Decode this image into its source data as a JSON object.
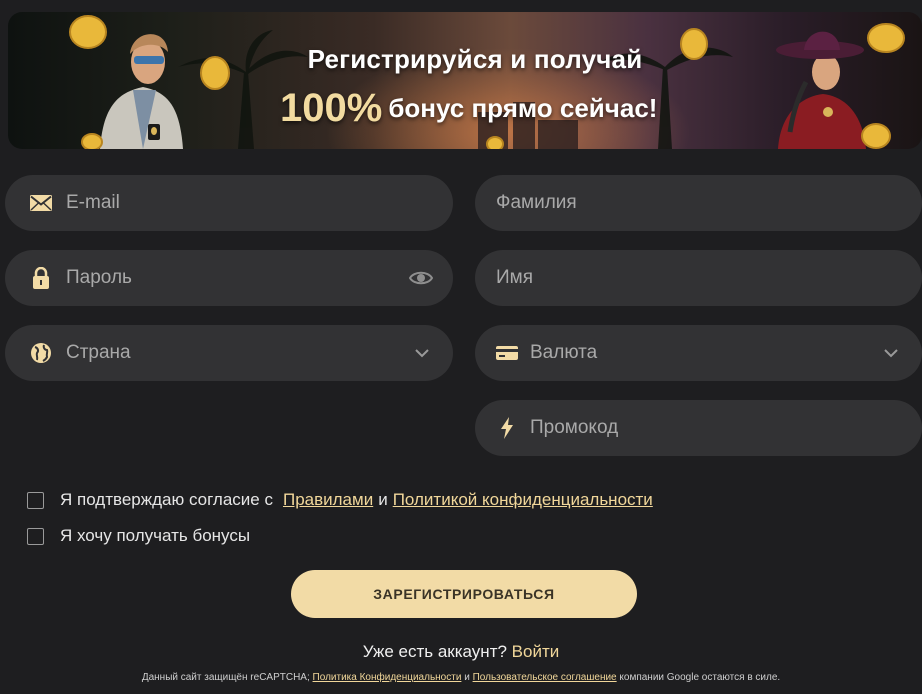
{
  "banner": {
    "line1": "Регистрируйся и получай",
    "percent": "100%",
    "line2_rest": "бонус прямо сейчас!"
  },
  "fields": {
    "email": {
      "placeholder": "E-mail",
      "icon": "envelope-icon"
    },
    "password": {
      "placeholder": "Пароль",
      "icon": "lock-icon",
      "trailing_icon": "eye-icon"
    },
    "country": {
      "placeholder": "Страна",
      "icon": "globe-icon",
      "trailing_icon": "chevron-down-icon"
    },
    "surname": {
      "placeholder": "Фамилия"
    },
    "name": {
      "placeholder": "Имя"
    },
    "currency": {
      "placeholder": "Валюта",
      "icon": "card-icon",
      "trailing_icon": "chevron-down-icon"
    },
    "promo": {
      "placeholder": "Промокод",
      "icon": "lightning-icon"
    }
  },
  "agreements": {
    "rules_text": "Я подтверждаю согласие с",
    "rules_link": "Правилами",
    "and": "и",
    "privacy_link": "Политикой конфиденциальности",
    "bonuses_text": "Я хочу получать бонусы"
  },
  "register_button": "ЗАРЕГИСТРИРОВАТЬСЯ",
  "account": {
    "question": "Уже есть аккаунт?",
    "login": "Войти"
  },
  "legal": {
    "prefix": "Данный сайт защищён reCAPTCHA;",
    "privacy_link": "Политика Конфиденциальности",
    "and": "и",
    "terms_link": "Пользовательское соглашение",
    "suffix": "компании Google остаются в силе."
  },
  "colors": {
    "background": "#1e1e20",
    "field": "#323234",
    "accent": "#f2dba6",
    "link": "#f1d79a"
  }
}
